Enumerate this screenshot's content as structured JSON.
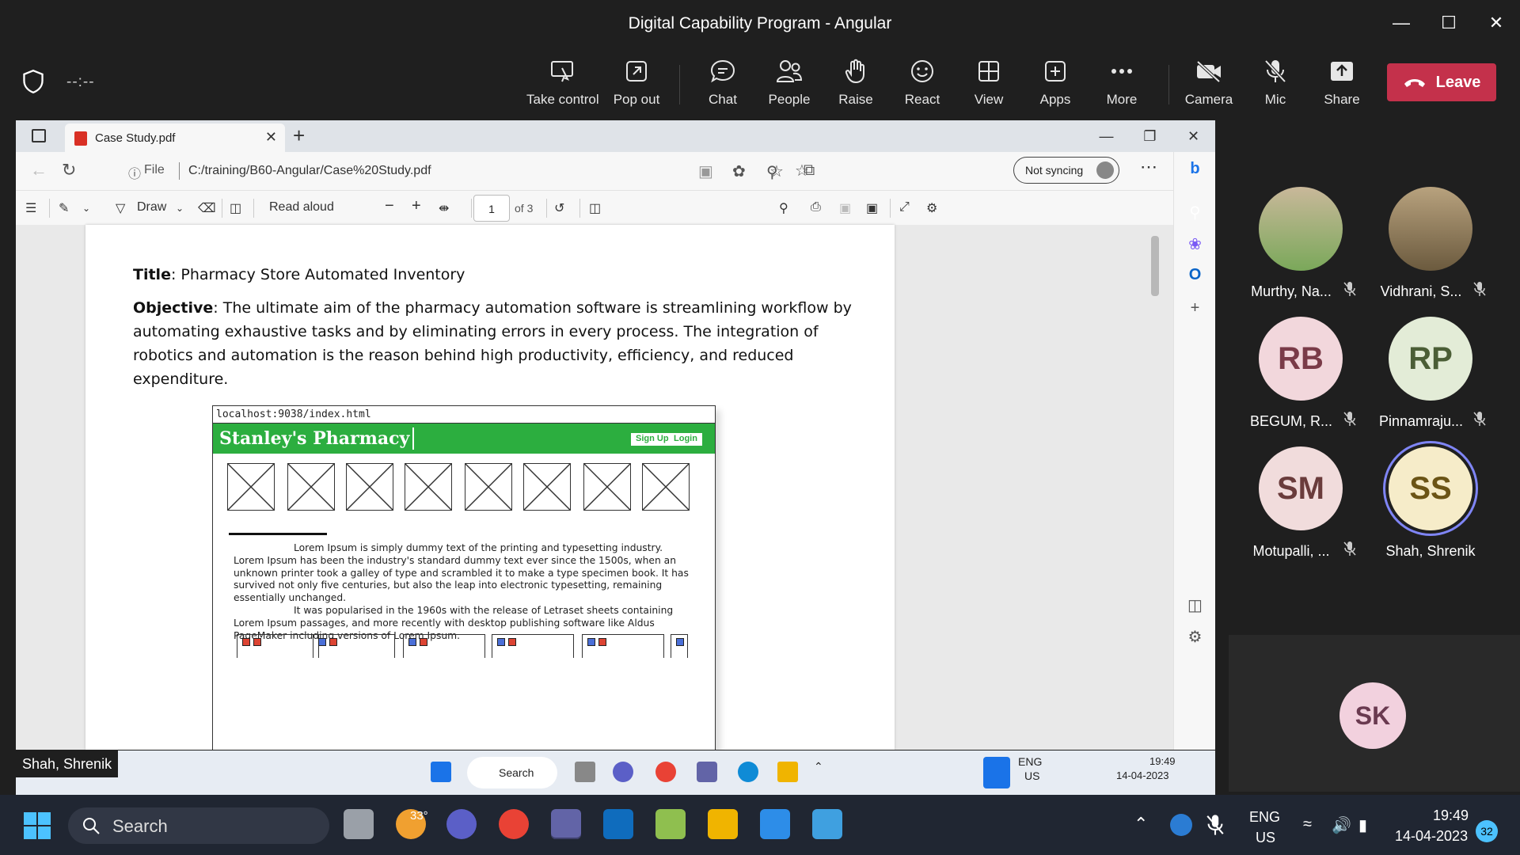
{
  "window": {
    "title": "Digital Capability Program - Angular"
  },
  "meeting": {
    "timer": "--:--",
    "toolbar": [
      {
        "label": "Take control",
        "icon": "take-control-icon"
      },
      {
        "label": "Pop out",
        "icon": "pop-out-icon"
      },
      {
        "label": "Chat",
        "icon": "chat-icon"
      },
      {
        "label": "People",
        "icon": "people-icon"
      },
      {
        "label": "Raise",
        "icon": "raise-hand-icon"
      },
      {
        "label": "React",
        "icon": "react-icon"
      },
      {
        "label": "View",
        "icon": "view-icon"
      },
      {
        "label": "Apps",
        "icon": "apps-icon"
      },
      {
        "label": "More",
        "icon": "more-icon"
      },
      {
        "label": "Camera",
        "icon": "camera-off-icon"
      },
      {
        "label": "Mic",
        "icon": "mic-off-icon"
      },
      {
        "label": "Share",
        "icon": "share-icon"
      }
    ],
    "leave_label": "Leave",
    "leave_color": "#c4314b"
  },
  "browser": {
    "tab_title": "Case Study.pdf",
    "url_scheme": "File",
    "url": "C:/training/B60-Angular/Case%20Study.pdf",
    "sync_label": "Not syncing",
    "pdf_toolbar": {
      "draw_label": "Draw",
      "read_aloud_label": "Read aloud",
      "page_number": "1",
      "page_total": "of 3"
    }
  },
  "document": {
    "title_label": "Title",
    "title_text": ": Pharmacy Store Automated Inventory",
    "objective_label": "Objective",
    "objective_text": ": The ultimate aim of the pharmacy automation software is streamlining workflow by automating exhaustive tasks and by eliminating errors in every process. The integration of robotics and automation is the reason behind high productivity, efficiency, and reduced expenditure.",
    "mockup": {
      "url": "localhost:9038/index.html",
      "brand": "Stanley's Pharmacy",
      "signup_label": "Sign Up",
      "login_label": "Login",
      "lorem_p1": "Lorem Ipsum is simply dummy text of the printing and typesetting industry. Lorem Ipsum has been the industry's standard dummy text ever since the 1500s, when an unknown printer took a galley of type and scrambled it to make a type specimen book. It has survived not only five centuries, but also the leap into electronic typesetting, remaining essentially unchanged.",
      "lorem_p2": "It was popularised in the 1960s with the release of Letraset sheets containing Lorem Ipsum passages, and more recently with desktop publishing software like Aldus PageMaker including versions of Lorem Ipsum.",
      "brand_color": "#2cae3f"
    }
  },
  "presenter_caption": "Shah, Shrenik",
  "remote_taskbar": {
    "search_label": "Search",
    "lang": "ENG",
    "region": "US",
    "time": "19:49",
    "date": "14-04-2023"
  },
  "participants": [
    {
      "initials": "",
      "name": "Murthy, Na...",
      "muted": true,
      "avatar": "photo"
    },
    {
      "initials": "",
      "name": "Vidhrani, S...",
      "muted": true,
      "avatar": "photo"
    },
    {
      "initials": "RB",
      "name": "BEGUM, R...",
      "muted": true,
      "color": "#f2d7dc"
    },
    {
      "initials": "RP",
      "name": "Pinnamraju...",
      "muted": true,
      "color": "#e3ecd7"
    },
    {
      "initials": "SM",
      "name": "Motupalli, ...",
      "muted": true,
      "color": "#f1dcdc"
    },
    {
      "initials": "SS",
      "name": "Shah, Shrenik",
      "muted": false,
      "color": "#f6ecc9"
    }
  ],
  "self_view": {
    "initials": "SK"
  },
  "taskbar": {
    "search_label": "Search",
    "weather": "33°",
    "lang": "ENG",
    "region": "US",
    "time": "19:49",
    "date": "14-04-2023",
    "notifications": "32"
  }
}
